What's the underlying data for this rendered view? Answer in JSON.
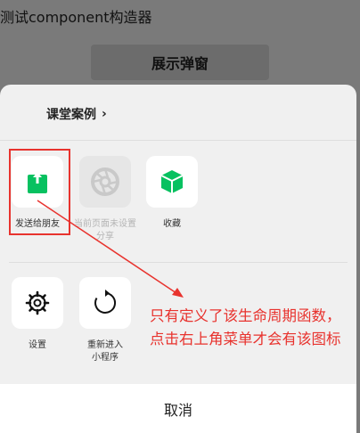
{
  "page": {
    "title": "测试component构造器"
  },
  "trigger_button": {
    "label": "展示弹窗"
  },
  "sheet": {
    "header_link": "课堂案例",
    "row1": [
      {
        "label": "发送给朋友",
        "icon": "share-icon",
        "color": "#07c160"
      },
      {
        "label": "当前页面未设置分享",
        "icon": "shutter-icon",
        "color": "#c9c9c9"
      },
      {
        "label": "收藏",
        "icon": "cube-icon",
        "color": "#07c160"
      }
    ],
    "row2": [
      {
        "label": "设置",
        "icon": "gear-icon"
      },
      {
        "label": "重新进入小程序",
        "icon": "reload-icon"
      }
    ],
    "cancel_label": "取消"
  },
  "annotation": {
    "text": "只有定义了该生命周期函数，点击右上角菜单才会有该图标",
    "color": "#e8332e"
  }
}
